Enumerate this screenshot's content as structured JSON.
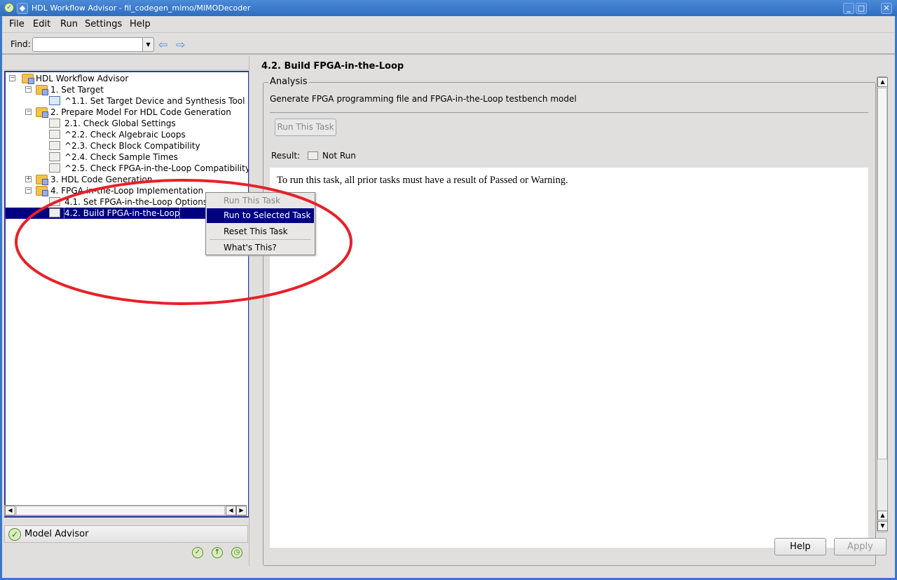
{
  "window": {
    "title": "HDL Workflow Advisor - fil_codegen_mimo/MIMODecoder",
    "minimize": "_",
    "maximize": "□",
    "close": "✕"
  },
  "menu": [
    "File",
    "Edit",
    "Run",
    "Settings",
    "Help"
  ],
  "find": {
    "label": "Find:",
    "value": ""
  },
  "tree": [
    {
      "label": "HDL Workflow Advisor",
      "level": 0,
      "expander": "⊟"
    },
    {
      "label": "1. Set Target",
      "level": 1,
      "expander": "⊟"
    },
    {
      "label": "^1.1. Set Target Device and Synthesis Tool",
      "level": 2
    },
    {
      "label": "2. Prepare Model For HDL Code Generation",
      "level": 1,
      "expander": "⊟"
    },
    {
      "label": "2.1. Check Global Settings",
      "level": 2
    },
    {
      "label": "^2.2. Check Algebraic Loops",
      "level": 2
    },
    {
      "label": "^2.3. Check Block Compatibility",
      "level": 2
    },
    {
      "label": "^2.4. Check Sample Times",
      "level": 2
    },
    {
      "label": "^2.5. Check FPGA-in-the-Loop Compatibility",
      "level": 2
    },
    {
      "label": "3. HDL Code Generation",
      "level": 1,
      "expander": "⊞"
    },
    {
      "label": "4. FPGA-in-the-Loop Implementation",
      "level": 1,
      "expander": "⊟"
    },
    {
      "label": "4.1. Set FPGA-in-the-Loop Options",
      "level": 2
    },
    {
      "label": "4.2. Build FPGA-in-the-Loop",
      "level": 2,
      "selected": true
    }
  ],
  "context_menu": [
    "Run This Task",
    "Run to Selected Task",
    "Reset This Task",
    "What's This?"
  ],
  "model_advisor": "Model Advisor",
  "detail": {
    "title": "4.2. Build FPGA-in-the-Loop",
    "group": "Analysis",
    "description": "Generate FPGA programming file and FPGA-in-the-Loop testbench model",
    "run_button": "Run This Task",
    "result_label": "Result:",
    "result_value": "Not Run",
    "message": "To run this task, all prior tasks must have a result of Passed or Warning."
  },
  "buttons": {
    "help": "Help",
    "apply": "Apply"
  },
  "colors": {
    "selection": "#000080",
    "annotation": "#e8202a"
  }
}
